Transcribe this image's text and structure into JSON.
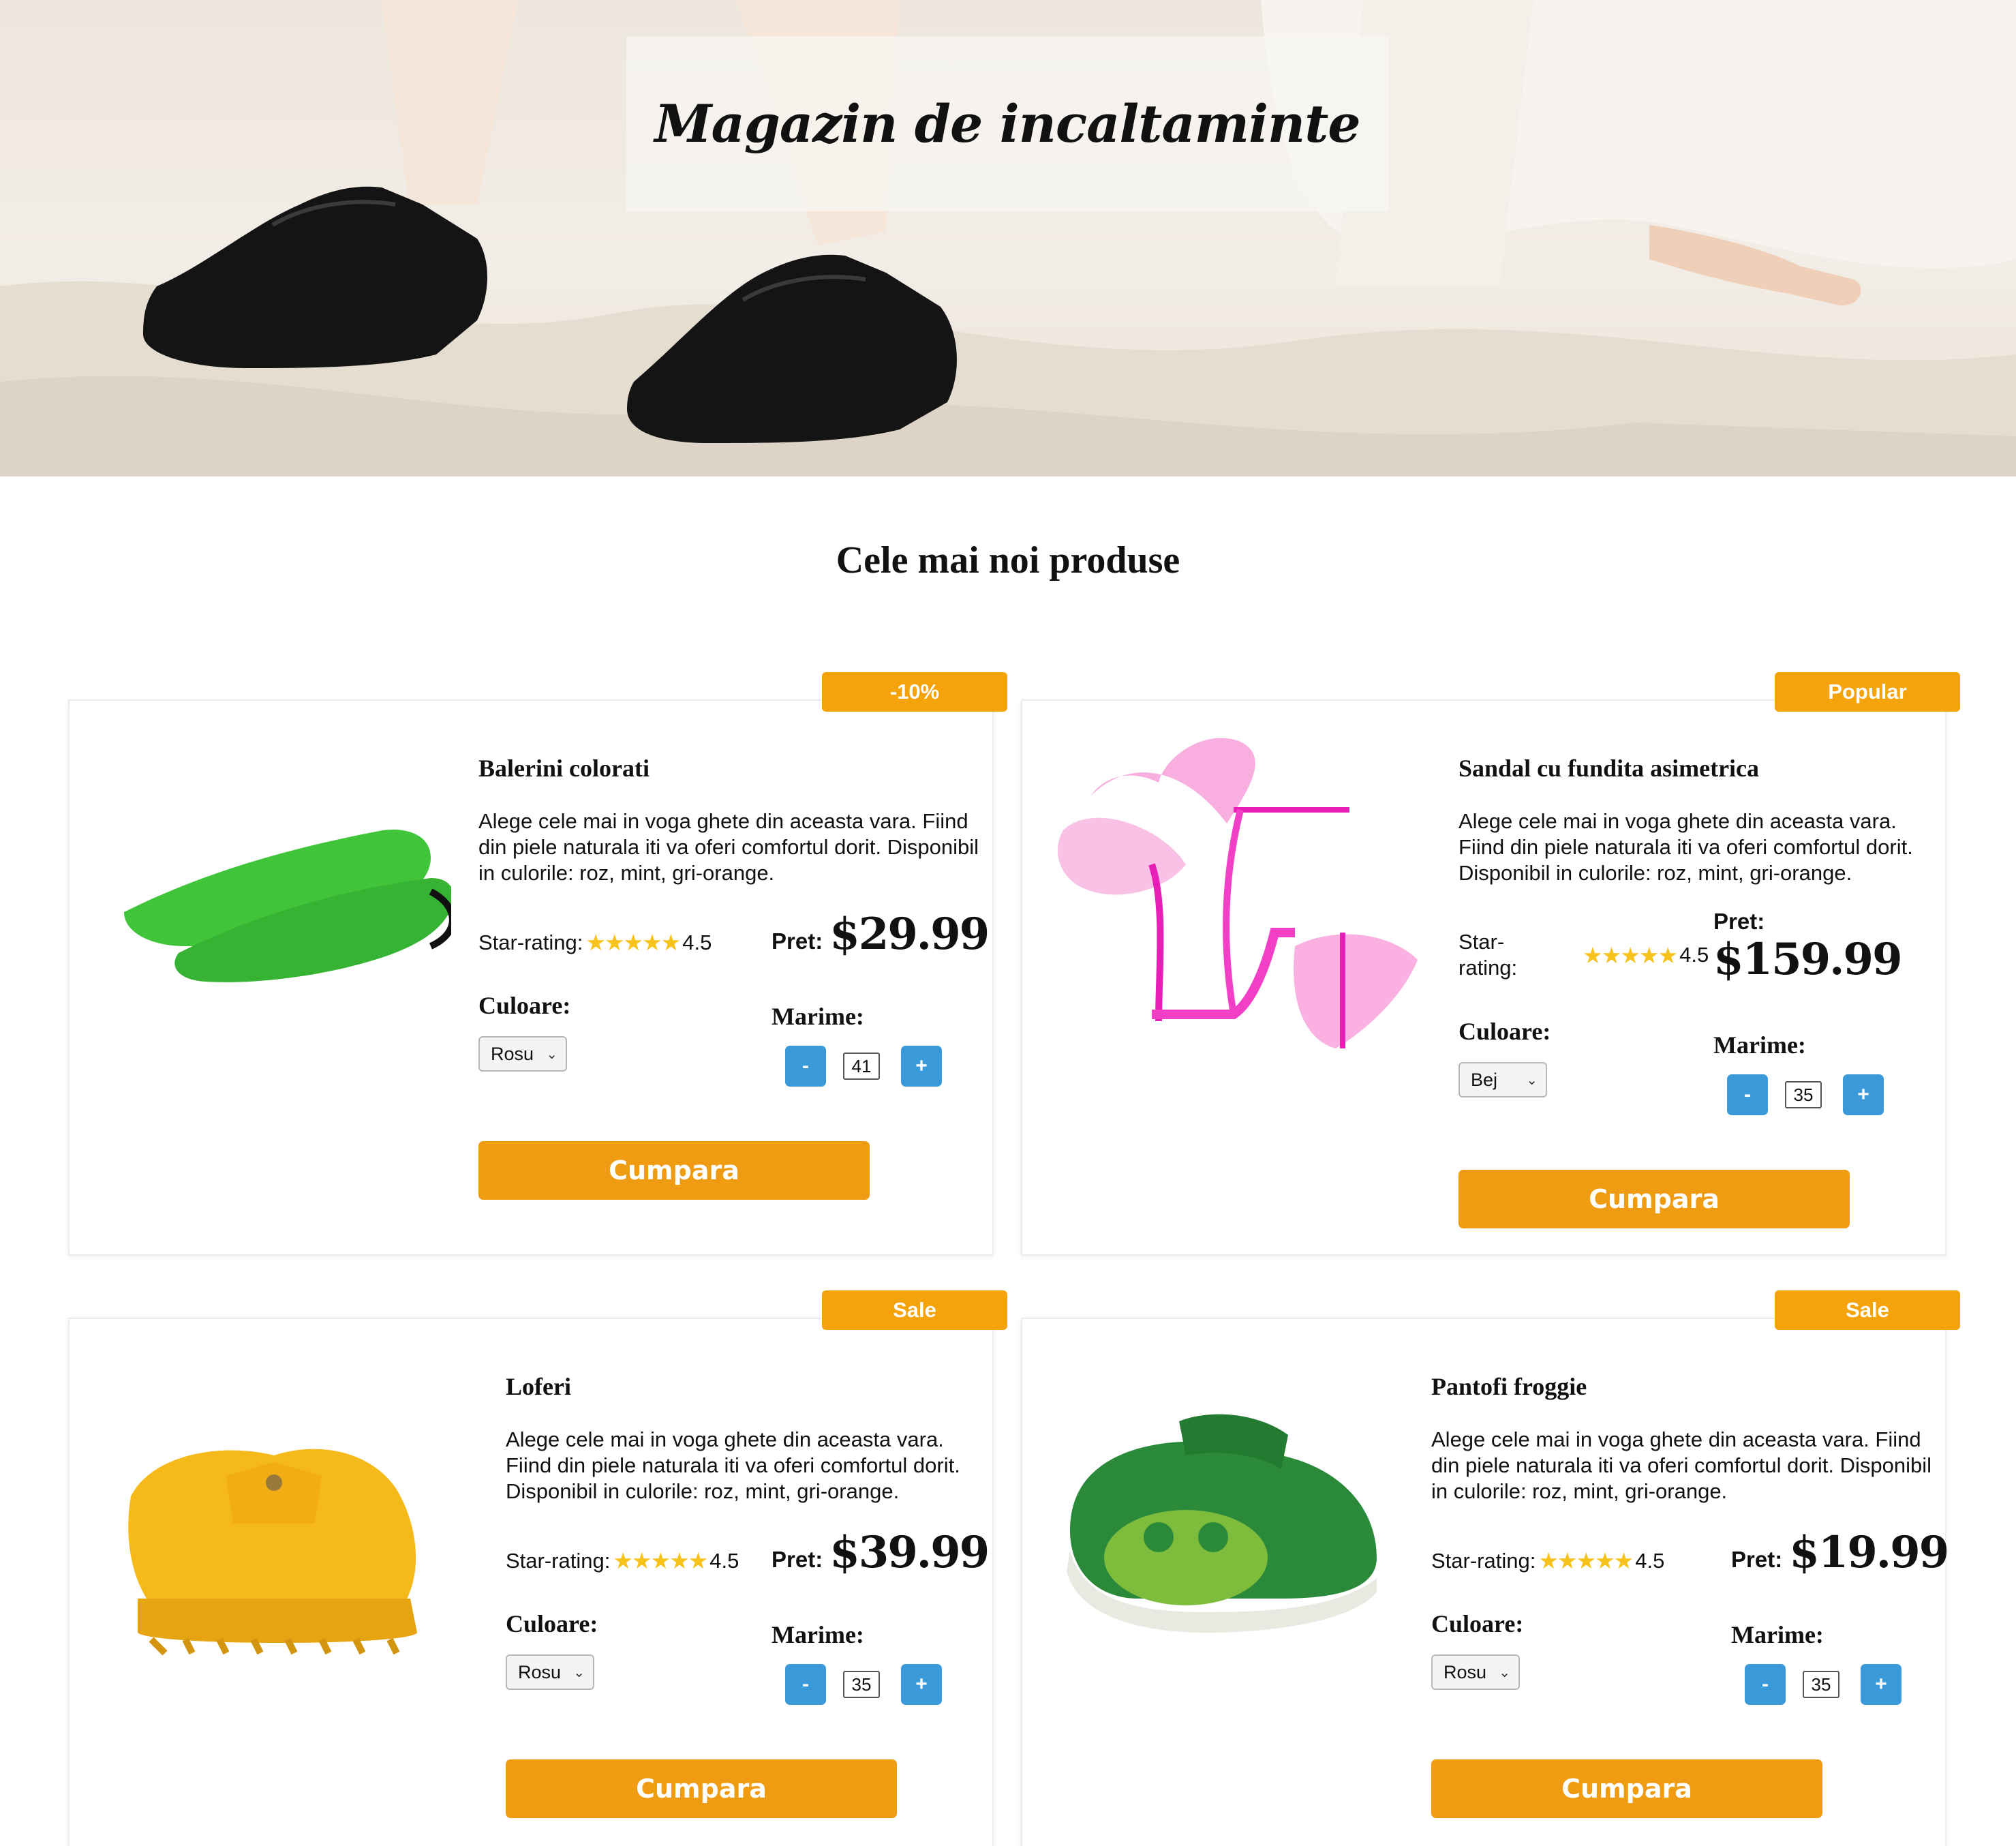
{
  "hero": {
    "title": "Magazin de incaltaminte"
  },
  "section": {
    "title": "Cele mai noi produse"
  },
  "labels": {
    "rating": "Star-rating:",
    "rating_split_a": "Star-",
    "rating_split_b": "rating:",
    "price": "Pret:",
    "color": "Culoare:",
    "size": "Marime:",
    "minus": "-",
    "plus": "+",
    "buy": "Cumpara",
    "stars": "★★★★★"
  },
  "products": [
    {
      "badge": "-10%",
      "name": "Balerini colorati",
      "description": "Alege cele mai in voga ghete din aceasta vara. Fiind din piele naturala iti va oferi comfortul dorit. Disponibil in culorile: roz, mint, gri-orange.",
      "rating": "4.5",
      "price": "$29.99",
      "color": "Rosu",
      "size": "41",
      "shoe_color": "#3fc43a"
    },
    {
      "badge": "Popular",
      "name": "Sandal cu fundita asimetrica",
      "description": "Alege cele mai in voga ghete din aceasta vara. Fiind din piele naturala iti va oferi comfortul dorit. Disponibil in culorile: roz, mint, gri-orange.",
      "rating": "4.5",
      "price": "$159.99",
      "color": "Bej",
      "size": "35",
      "shoe_color": "#f13fc6"
    },
    {
      "badge": "Sale",
      "name": "Loferi",
      "description": "Alege cele mai in voga ghete din aceasta vara. Fiind din piele naturala iti va oferi comfortul dorit. Disponibil in culorile: roz, mint, gri-orange.",
      "rating": "4.5",
      "price": "$39.99",
      "color": "Rosu",
      "size": "35",
      "shoe_color": "#f6b91a"
    },
    {
      "badge": "Sale",
      "name": "Pantofi froggie",
      "description": "Alege cele mai in voga ghete din aceasta vara. Fiind din piele naturala iti va oferi comfortul dorit. Disponibil in culorile: roz, mint, gri-orange.",
      "rating": "4.5",
      "price": "$19.99",
      "color": "Rosu",
      "size": "35",
      "shoe_color": "#2b8a3a"
    }
  ],
  "colors": {
    "accent": "#f09c12",
    "badge": "#f5a30a",
    "qty_button": "#3a9ad9",
    "star": "#f7c21b"
  }
}
